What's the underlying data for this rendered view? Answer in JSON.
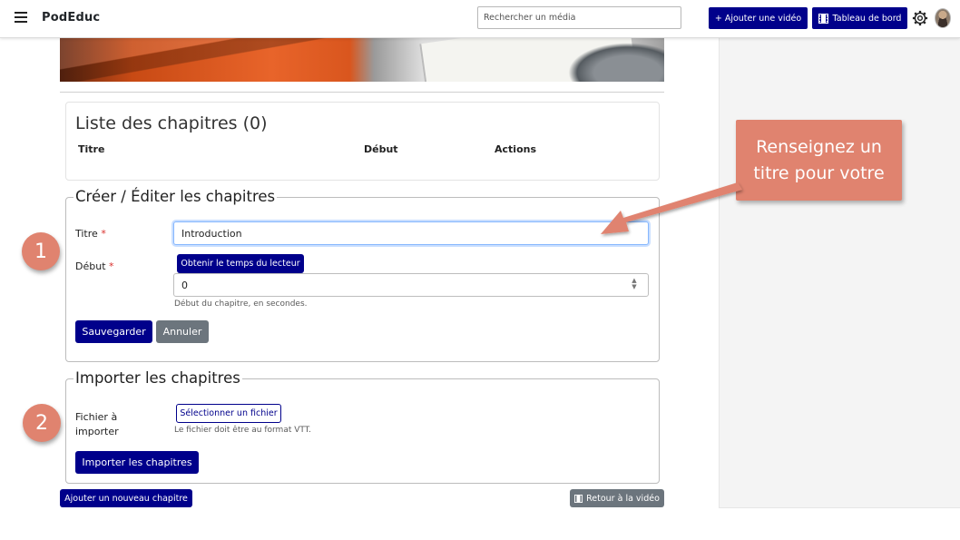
{
  "header": {
    "brand": "PodEduc",
    "search_placeholder": "Rechercher un média",
    "add_video": "+ Ajouter une vidéo",
    "dashboard": "Tableau de bord"
  },
  "chapters_list": {
    "title": "Liste des chapitres (0)",
    "columns": [
      "Titre",
      "Début",
      "Actions"
    ]
  },
  "edit_section": {
    "legend": "Créer / Éditer les chapitres",
    "title_label": "Titre",
    "title_value": "Introduction",
    "start_label": "Début",
    "required_mark": "*",
    "get_time_button": "Obtenir le temps du lecteur",
    "start_value": "0",
    "start_help": "Début du chapitre, en secondes.",
    "save_button": "Sauvegarder",
    "cancel_button": "Annuler"
  },
  "import_section": {
    "legend": "Importer les chapitres",
    "file_label_line1": "Fichier à",
    "file_label_line2": "importer",
    "select_file_button": "Sélectionner un fichier",
    "file_help": "Le fichier doit être au format VTT.",
    "import_button": "Importer les chapitres"
  },
  "footer_actions": {
    "add_chapter": "Ajouter un nouveau chapitre",
    "back_to_video": "Retour à la vidéo"
  },
  "annotations": {
    "step1": "1",
    "step2": "2",
    "callout_line1": "Renseignez un",
    "callout_line2": "titre pour votre",
    "color": "#e0836f"
  },
  "colors": {
    "primary": "#00008b",
    "secondary": "#6c757d",
    "required": "#d9302c"
  }
}
